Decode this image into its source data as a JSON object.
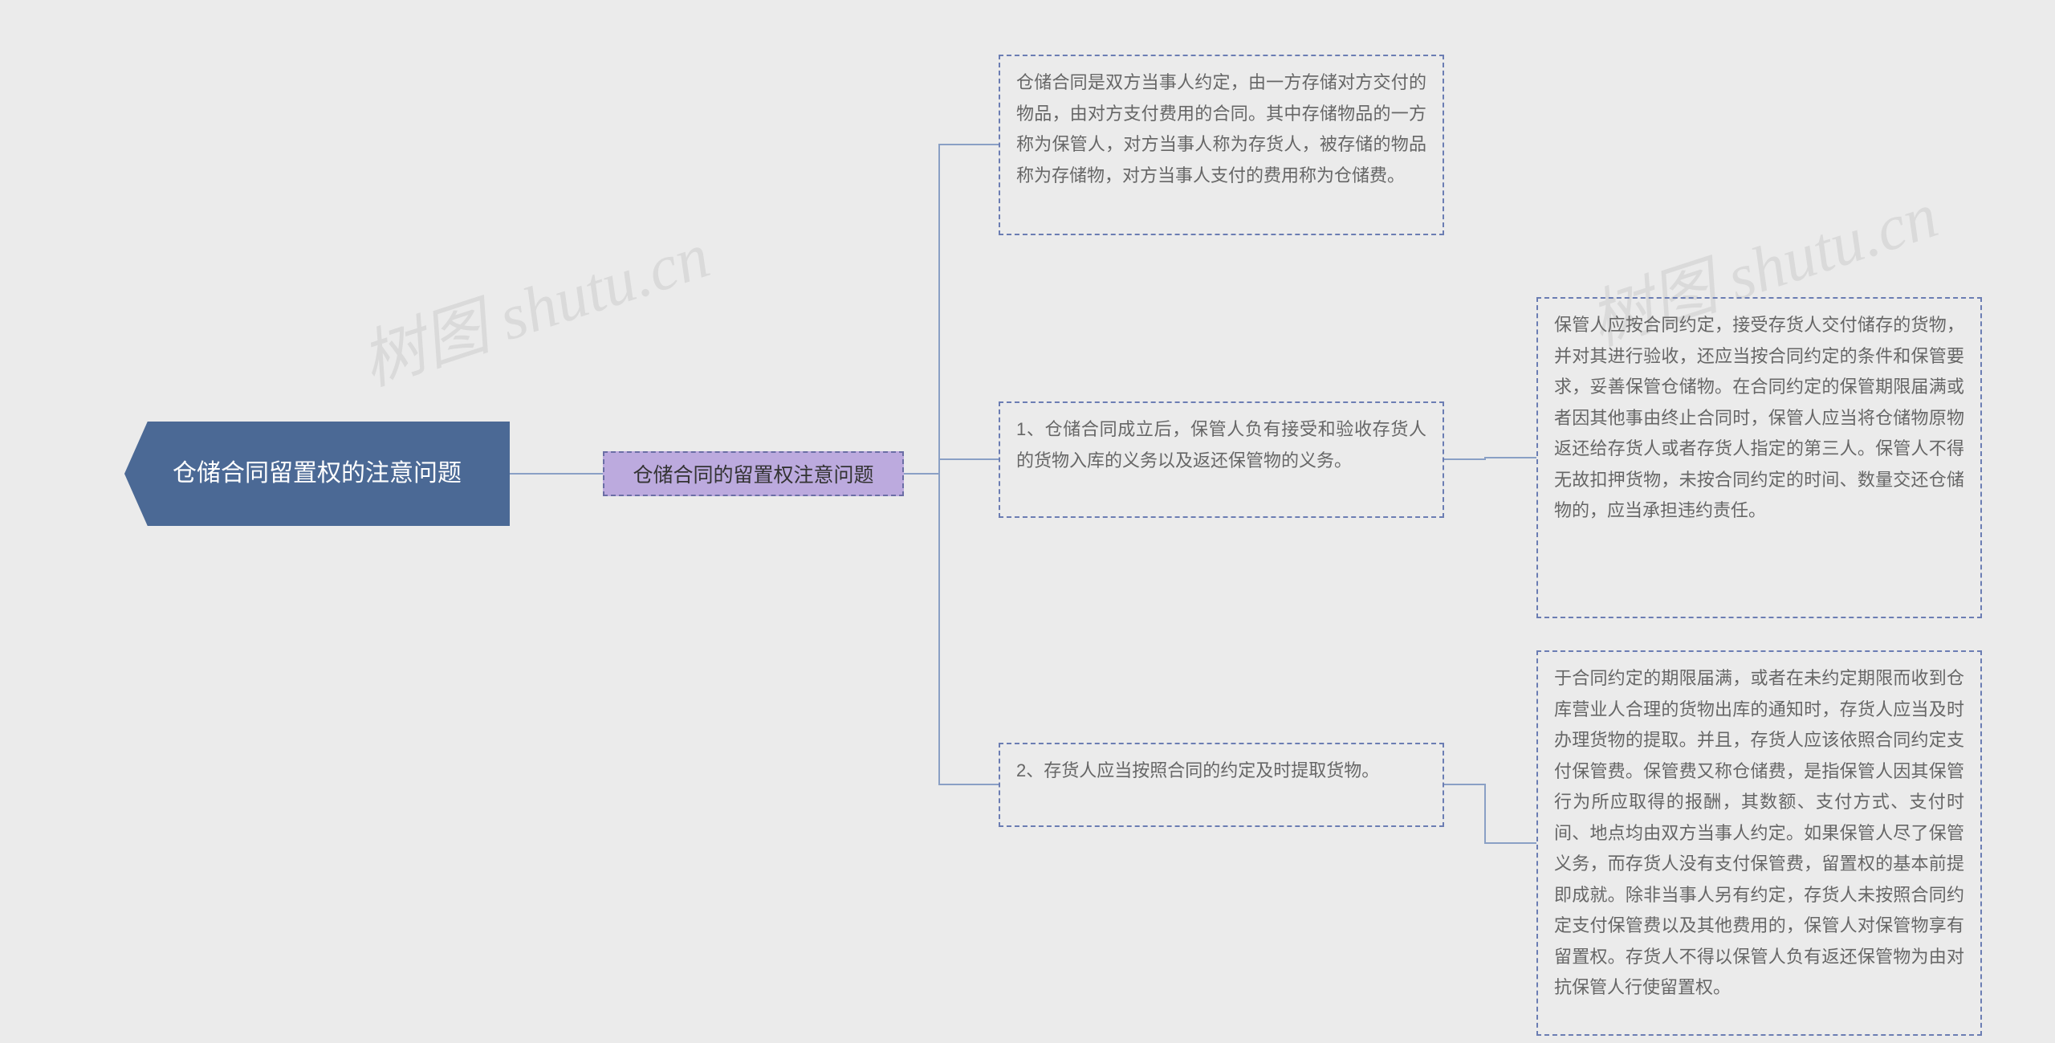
{
  "root": {
    "title": "仓储合同留置权的注意问题"
  },
  "category": {
    "label": "仓储合同的留置权注意问题"
  },
  "leaves": {
    "intro": "仓储合同是双方当事人约定，由一方存储对方交付的物品，由对方支付费用的合同。其中存储物品的一方称为保管人，对方当事人称为存货人，被存储的物品称为存储物，对方当事人支付的费用称为仓储费。",
    "p1": "1、仓储合同成立后，保管人负有接受和验收存货人的货物入库的义务以及返还保管物的义务。",
    "p1_detail": "保管人应按合同约定，接受存货人交付储存的货物，并对其进行验收，还应当按合同约定的条件和保管要求，妥善保管仓储物。在合同约定的保管期限届满或者因其他事由终止合同时，保管人应当将仓储物原物返还给存货人或者存货人指定的第三人。保管人不得无故扣押货物，未按合同约定的时间、数量交还仓储物的，应当承担违约责任。",
    "p2": "2、存货人应当按照合同的约定及时提取货物。",
    "p2_detail": "于合同约定的期限届满，或者在未约定期限而收到仓库营业人合理的货物出库的通知时，存货人应当及时办理货物的提取。并且，存货人应该依照合同约定支付保管费。保管费又称仓储费，是指保管人因其保管行为所应取得的报酬，其数额、支付方式、支付时间、地点均由双方当事人约定。如果保管人尽了保管义务，而存货人没有支付保管费，留置权的基本前提即成就。除非当事人另有约定，存货人未按照合同约定支付保管费以及其他费用的，保管人对保管物享有留置权。存货人不得以保管人负有返还保管物为由对抗保管人行使留置权。"
  },
  "watermark": {
    "text1": "树图 shutu.cn",
    "text2": "树图 shutu.cn"
  }
}
